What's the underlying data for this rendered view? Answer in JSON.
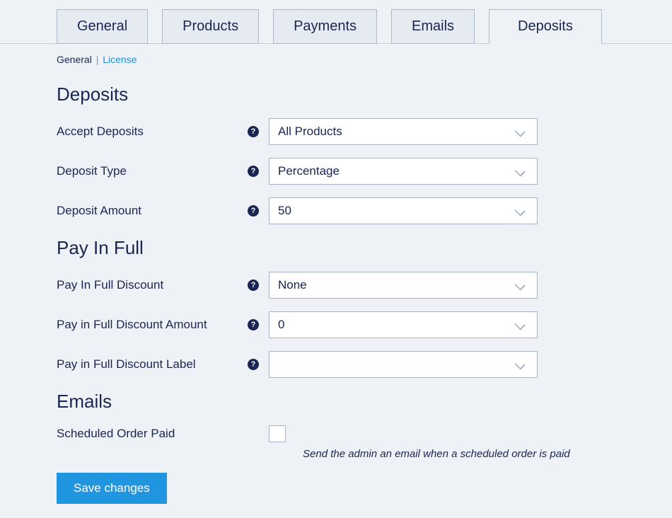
{
  "tabs": {
    "general": "General",
    "products": "Products",
    "payments": "Payments",
    "emails": "Emails",
    "deposits": "Deposits"
  },
  "subnav": {
    "general": "General",
    "license": "License"
  },
  "sections": {
    "deposits": {
      "heading": "Deposits",
      "fields": {
        "accept": {
          "label": "Accept Deposits",
          "value": "All Products"
        },
        "type": {
          "label": "Deposit Type",
          "value": "Percentage"
        },
        "amount": {
          "label": "Deposit Amount",
          "value": "50"
        }
      }
    },
    "payfull": {
      "heading": "Pay In Full",
      "fields": {
        "discount": {
          "label": "Pay In Full Discount",
          "value": "None"
        },
        "amount": {
          "label": "Pay in Full Discount Amount",
          "value": "0"
        },
        "labelfield": {
          "label": "Pay in Full Discount Label",
          "value": ""
        }
      }
    },
    "emails": {
      "heading": "Emails",
      "fields": {
        "scheduled": {
          "label": "Scheduled Order Paid",
          "description": "Send the admin an email when a scheduled order is paid"
        }
      }
    }
  },
  "buttons": {
    "save": "Save changes"
  }
}
